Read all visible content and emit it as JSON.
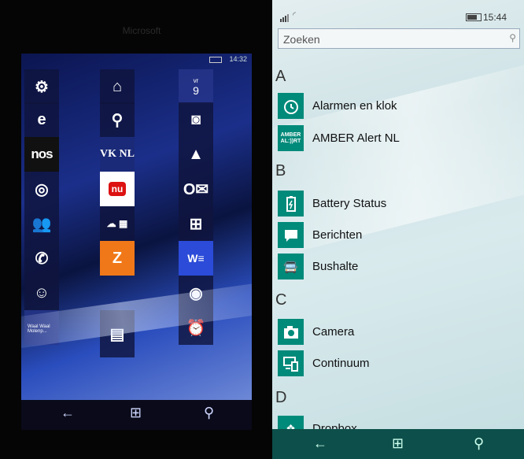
{
  "left_phone": {
    "brand": "Microsoft",
    "time": "14:32",
    "date": {
      "dow": "vr",
      "day": "9"
    },
    "tiles": {
      "vknl": "VK NL",
      "nos": "nos",
      "weather": "Waal Waal Molenp..."
    }
  },
  "status_bar": {
    "time": "15:44"
  },
  "search": {
    "placeholder": "Zoeken"
  },
  "sections": [
    {
      "letter": "A",
      "apps": [
        "Alarmen en klok",
        "AMBER Alert NL"
      ]
    },
    {
      "letter": "B",
      "apps": [
        "Battery Status",
        "Berichten",
        "Bushalte"
      ]
    },
    {
      "letter": "C",
      "apps": [
        "Camera",
        "Continuum"
      ]
    },
    {
      "letter": "D",
      "apps": [
        "Dropbox"
      ]
    }
  ],
  "amber_icon_text": "AMBER AL:))RT",
  "colors": {
    "accent": "#008a7a",
    "nav": "#0d4f4a"
  },
  "icons": {
    "back": "back-arrow-icon",
    "home": "windows-icon",
    "search": "search-icon"
  }
}
